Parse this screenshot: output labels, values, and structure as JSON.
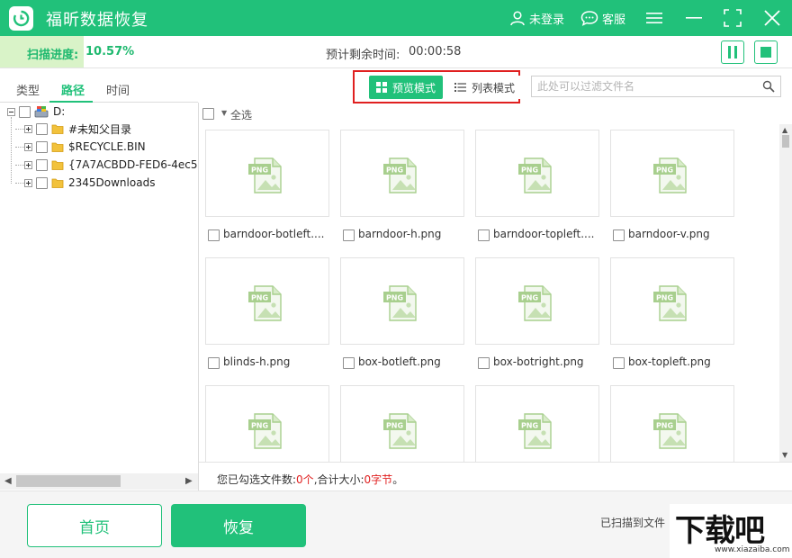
{
  "app": {
    "title": "福昕数据恢复",
    "accent_color": "#21c17a"
  },
  "titlebar": {
    "user_label": "未登录",
    "service_label": "客服",
    "icons": [
      "user-icon",
      "chat-icon",
      "menu-icon",
      "minimize-icon",
      "fullscreen-icon",
      "close-icon"
    ]
  },
  "progress": {
    "label": "扫描进度:",
    "value": "10.57%",
    "fraction": 0.1057,
    "remaining_label": "预计剩余时间:",
    "remaining_value": "00:00:58"
  },
  "left_tabs": [
    {
      "label": "类型",
      "active": false
    },
    {
      "label": "路径",
      "active": true
    },
    {
      "label": "时间",
      "active": false
    }
  ],
  "tree": {
    "root": {
      "label": "D:"
    },
    "children": [
      {
        "label": "#未知父目录"
      },
      {
        "label": "$RECYCLE.BIN"
      },
      {
        "label": "{7A7ACBDD-FED6-4ec5-"
      },
      {
        "label": "2345Downloads"
      }
    ]
  },
  "view_modes": {
    "preview_label": "预览模式",
    "list_label": "列表模式",
    "active": "preview"
  },
  "search": {
    "placeholder": "此处可以过滤文件名",
    "value": ""
  },
  "select_all_label": "全选",
  "files": [
    {
      "name": "barndoor-botleft....",
      "type": "PNG"
    },
    {
      "name": "barndoor-h.png",
      "type": "PNG"
    },
    {
      "name": "barndoor-topleft....",
      "type": "PNG"
    },
    {
      "name": "barndoor-v.png",
      "type": "PNG"
    },
    {
      "name": "blinds-h.png",
      "type": "PNG"
    },
    {
      "name": "box-botleft.png",
      "type": "PNG"
    },
    {
      "name": "box-botright.png",
      "type": "PNG"
    },
    {
      "name": "box-topleft.png",
      "type": "PNG"
    },
    {
      "name": "",
      "type": "PNG"
    },
    {
      "name": "",
      "type": "PNG"
    },
    {
      "name": "",
      "type": "PNG"
    },
    {
      "name": "",
      "type": "PNG"
    }
  ],
  "status": {
    "prefix": "您已勾选文件数:",
    "count": "0个",
    "size_label": ",合计大小:",
    "size": "0字节",
    "suffix": "。"
  },
  "bottom": {
    "home_label": "首页",
    "recover_label": "恢复",
    "scanned_label": "已扫描到文件"
  },
  "watermark": {
    "main": "下载吧",
    "sub": "www.xiazaiba.com"
  }
}
